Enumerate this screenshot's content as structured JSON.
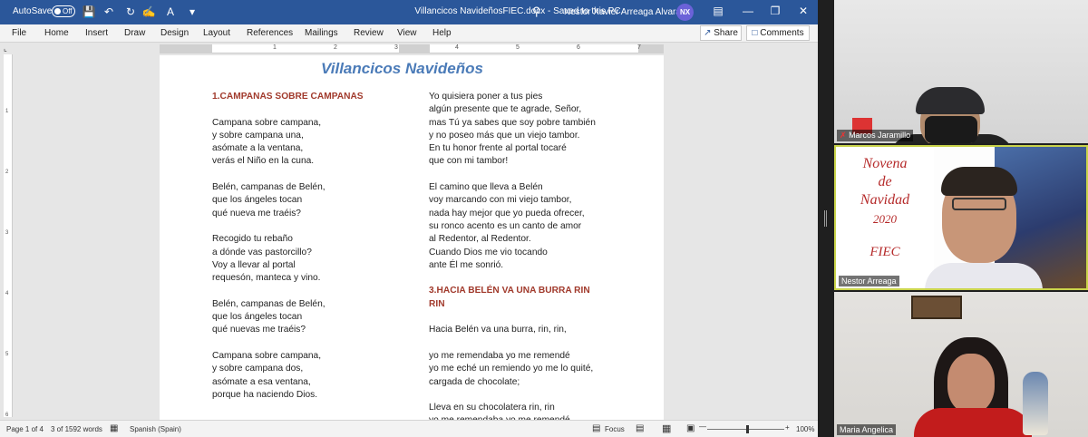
{
  "titlebar": {
    "autosave_label": "AutoSave",
    "autosave_state": "Off",
    "document_title": "Villancicos NavideñosFIEC.docx  -  Saved to this PC",
    "user_name": "Nestor Xavier Arreaga Alvarado",
    "user_initials": "NX"
  },
  "ribbon": {
    "tabs": [
      "File",
      "Home",
      "Insert",
      "Draw",
      "Design",
      "Layout",
      "References",
      "Mailings",
      "Review",
      "View",
      "Help"
    ],
    "share_label": "Share",
    "comments_label": "Comments"
  },
  "ruler": {
    "numbers": [
      "1",
      "2",
      "3",
      "4",
      "5",
      "6",
      "7"
    ]
  },
  "vruler": {
    "numbers": [
      "1",
      "2",
      "3",
      "4",
      "5",
      "6"
    ]
  },
  "document": {
    "heading": "Villancicos Navideños",
    "column1": [
      {
        "type": "title",
        "text": "1.CAMPANAS SOBRE CAMPANAS"
      },
      {
        "type": "gap"
      },
      {
        "type": "line",
        "text": "Campana sobre campana,"
      },
      {
        "type": "line",
        "text": "y sobre campana una,"
      },
      {
        "type": "line",
        "text": "asómate a la ventana,"
      },
      {
        "type": "line",
        "text": "verás el Niño en la cuna."
      },
      {
        "type": "gap"
      },
      {
        "type": "line",
        "text": "Belén, campanas de Belén,"
      },
      {
        "type": "line",
        "text": "que los ángeles tocan"
      },
      {
        "type": "line",
        "text": "qué nueva me traéis?"
      },
      {
        "type": "gap"
      },
      {
        "type": "line",
        "text": "Recogido tu rebaño"
      },
      {
        "type": "line",
        "text": "a dónde vas pastorcillo?"
      },
      {
        "type": "line",
        "text": "Voy a llevar al portal"
      },
      {
        "type": "line",
        "text": "requesón, manteca y vino."
      },
      {
        "type": "gap"
      },
      {
        "type": "line",
        "text": "Belén, campanas de Belén,"
      },
      {
        "type": "line",
        "text": "que los ángeles tocan"
      },
      {
        "type": "line",
        "text": "qué nuevas me traéis?"
      },
      {
        "type": "gap"
      },
      {
        "type": "line",
        "text": "Campana sobre campana,"
      },
      {
        "type": "line",
        "text": "y sobre campana dos,"
      },
      {
        "type": "line",
        "text": "asómate a esa ventana,"
      },
      {
        "type": "line",
        "text": "porque ha naciendo Dios."
      }
    ],
    "column2": [
      {
        "type": "line",
        "text": "Yo quisiera poner a tus pies"
      },
      {
        "type": "line",
        "text": "algún presente que te agrade, Señor,"
      },
      {
        "type": "line",
        "text": "mas Tú ya sabes que soy pobre también"
      },
      {
        "type": "line",
        "text": "y no poseo más que un viejo tambor."
      },
      {
        "type": "line",
        "text": "En tu honor frente al portal tocaré"
      },
      {
        "type": "line",
        "text": "que con mi tambor!"
      },
      {
        "type": "gap"
      },
      {
        "type": "line",
        "text": "El camino que lleva a Belén"
      },
      {
        "type": "line",
        "text": "voy marcando con mi viejo tambor,"
      },
      {
        "type": "line",
        "text": "nada hay mejor que yo pueda ofrecer,"
      },
      {
        "type": "line",
        "text": "su ronco acento es un canto de amor"
      },
      {
        "type": "line",
        "text": "al Redentor, al Redentor."
      },
      {
        "type": "line",
        "text": "Cuando Dios me vio tocando"
      },
      {
        "type": "line",
        "text": "ante Él me sonrió."
      },
      {
        "type": "gap"
      },
      {
        "type": "title",
        "text": "3.HACIA BELÉN VA UNA BURRA RIN"
      },
      {
        "type": "title",
        "text": "RIN"
      },
      {
        "type": "gap"
      },
      {
        "type": "line",
        "text": "Hacia Belén va una burra, rin, rin,"
      },
      {
        "type": "gap"
      },
      {
        "type": "line",
        "text": "yo me remendaba yo me remendé"
      },
      {
        "type": "line",
        "text": "yo me eché un remiendo yo me lo quité,"
      },
      {
        "type": "line",
        "text": "cargada de chocolate;"
      },
      {
        "type": "gap"
      },
      {
        "type": "line",
        "text": "Lleva en su chocolatera rin, rin"
      },
      {
        "type": "line",
        "text": "yo me remendaba yo me remendé"
      }
    ]
  },
  "statusbar": {
    "page": "Page 1 of 4",
    "words": "3 of 1592 words",
    "language": "Spanish (Spain)",
    "focus": "Focus",
    "zoom": "100%"
  },
  "video": {
    "tile1_name": "Marcos Jaramillo",
    "tile2_name": "Nestor Arreaga",
    "tile3_name": "Maria Angelica",
    "poster_lines": [
      "Novena",
      "de",
      "Navidad",
      "2020",
      "FIEC"
    ]
  },
  "colors": {
    "word_blue": "#2b579a",
    "heading_blue": "#4b7bb8",
    "song_title_red": "#a13a2c",
    "active_speaker_border": "#c9d34a"
  }
}
